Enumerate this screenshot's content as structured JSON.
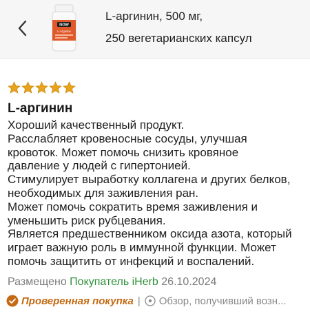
{
  "header": {
    "back_icon": "chevron-left-icon",
    "product_image": "product-bottle-thumbnail",
    "title_line1": "L-аргинин, 500 мг,",
    "title_line2": "250 вегетарианских капсул",
    "thumbnail_brand": "NOW",
    "thumbnail_label": "L-Arginine"
  },
  "review": {
    "rating": 5,
    "rating_max": 5,
    "star_color": "#e8a31a",
    "title": "L-аргинин",
    "body_lines": [
      "Хороший качественный продукт.",
      "Расслабляет кровеносные сосуды, улучшая",
      "кровоток. Может помочь снизить кровяное",
      "давление у людей с гипертонией.",
      "Стимулирует выработку коллагена и других белков,",
      "необходимых для заживления ран.",
      "Может помочь сократить время заживления и",
      "уменьшить риск рубцевания.",
      "Является предшественником оксида азота, который",
      "играет важную роль в иммунной функции. Может",
      "помочь защитить от инфекций и воспалений."
    ],
    "posted_label": "Размещено",
    "author": "Покупатель iHerb",
    "date": "26.10.2024",
    "verified_label": "Проверенная покупка",
    "separator": "|",
    "disclaimer": "Обзор, получивший возн...",
    "colors": {
      "buyer_green": "#2f8f39",
      "verified_orange": "#c46a12"
    }
  }
}
